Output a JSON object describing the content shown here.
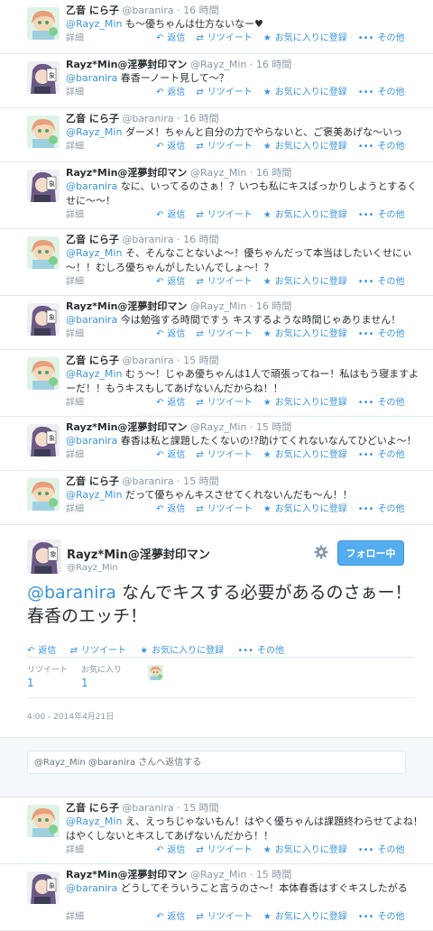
{
  "actions": {
    "detail": "詳細",
    "reply": "返信",
    "retweet": "リツイート",
    "favorite": "お気に入りに登録",
    "more": "その他"
  },
  "tweets_before": [
    {
      "name": "乙音 にら子",
      "handle": "@baranira",
      "time": "· 16 時間",
      "mention": "@Rayz_Min",
      "text": " も～優ちゃんは仕方ないなー♥",
      "avatar": "nira"
    },
    {
      "name": "Rayz*Min@淫夢封印マン",
      "handle": "@Rayz_Min",
      "time": "· 16 時間",
      "mention": "@baranira",
      "text": " 春香ーノート見して～？",
      "avatar": "min"
    },
    {
      "name": "乙音 にら子",
      "handle": "@baranira",
      "time": "· 16 時間",
      "mention": "@Rayz_Min",
      "text": " ダーメ！ちゃんと自分の力でやらないと、ご褒美あげな～いっ",
      "avatar": "nira"
    },
    {
      "name": "Rayz*Min@淫夢封印マン",
      "handle": "@Rayz_Min",
      "time": "· 16 時間",
      "mention": "@baranira",
      "text": " なに、いってるのさぁ！？いつも私にキスばっかりしようとするくせに～～！",
      "avatar": "min"
    },
    {
      "name": "乙音 にら子",
      "handle": "@baranira",
      "time": "· 16 時間",
      "mention": "@Rayz_Min",
      "text": " そ、そんなことないよ～！優ちゃんだって本当はしたいくせにぃ～！！むしろ優ちゃんがしたいんでしょ～！？",
      "avatar": "nira"
    },
    {
      "name": "Rayz*Min@淫夢封印マン",
      "handle": "@Rayz_Min",
      "time": "· 16 時間",
      "mention": "@baranira",
      "text": " 今は勉強する時間ですぅ キスするような時間じゃありません！",
      "avatar": "min"
    },
    {
      "name": "乙音 にら子",
      "handle": "@baranira",
      "time": "· 15 時間",
      "mention": "@Rayz_Min",
      "text": " むぅ～！じゃあ優ちゃんは1人で頑張ってねー！私はもう寝ますよーだ！！もうキスもしてあげないんだからね！！",
      "avatar": "nira"
    },
    {
      "name": "Rayz*Min@淫夢封印マン",
      "handle": "@Rayz_Min",
      "time": "· 15 時間",
      "mention": "@baranira",
      "text": " 春香は私と課題したくないの!?助けてくれないなんてひどいよ～！",
      "avatar": "min"
    },
    {
      "name": "乙音 にら子",
      "handle": "@baranira",
      "time": "· 15 時間",
      "mention": "@Rayz_Min",
      "text": " だって優ちゃんキスさせてくれないんだも～ん！！",
      "avatar": "nira"
    }
  ],
  "focus": {
    "name": "Rayz*Min@淫夢封印マン",
    "handle": "@Rayz_Min",
    "follow_label": "フォロー中",
    "mention": "@baranira",
    "text": " なんでキスする必要があるのさぁー！春香のエッチ！",
    "retweets_label": "リツイート",
    "retweets": "1",
    "favorites_label": "お気に入り",
    "favorites": "1",
    "timestamp": "4:00 - 2014年4月21日"
  },
  "reply_box": {
    "placeholder": "@Rayz_Min @baranira さんへ返信する"
  },
  "tweets_after": [
    {
      "name": "乙音 にら子",
      "handle": "@baranira",
      "time": "· 15 時間",
      "mention": "@Rayz_Min",
      "text": " え、えっちじゃないもん！はやく優ちゃんは課題終わらせてよね！はやくしないとキスしてあげないんだから！！",
      "avatar": "nira"
    },
    {
      "name": "Rayz*Min@淫夢封印マン",
      "handle": "@Rayz_Min",
      "time": "· 15 時間",
      "mention": "@baranira",
      "text": " どうしてそういうこと言うのさ～！本体春香はすぐキスしたがる",
      "avatar": "min"
    }
  ],
  "colors": {
    "accent": "#3b94d9",
    "follow": "#55acee",
    "muted": "#8899a6"
  }
}
